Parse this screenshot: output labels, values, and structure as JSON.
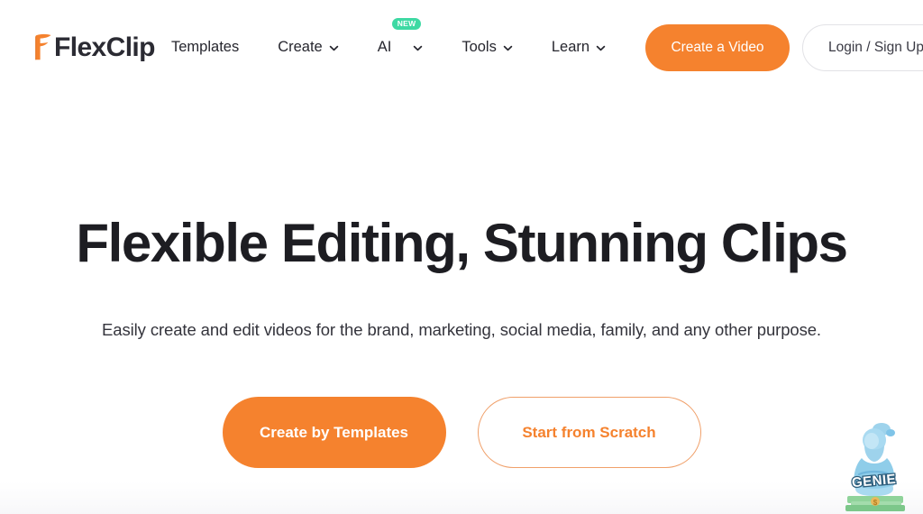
{
  "brand": {
    "name": "FlexClip",
    "logo_mark_icon": "flexclip-f-icon",
    "accent_color": "#F5822E",
    "logo_text_color": "#2B2B33"
  },
  "header": {
    "nav_items": [
      {
        "label": "Templates",
        "has_chevron": false,
        "badge": null,
        "icon": null
      },
      {
        "label": "Create",
        "has_chevron": true,
        "badge": null,
        "icon": "chevron-down-icon"
      },
      {
        "label": "AI",
        "has_chevron": true,
        "badge": "NEW",
        "icon": "chevron-down-icon"
      },
      {
        "label": "Tools",
        "has_chevron": true,
        "badge": null,
        "icon": "chevron-down-icon"
      },
      {
        "label": "Learn",
        "has_chevron": true,
        "badge": null,
        "icon": "chevron-down-icon"
      }
    ],
    "badge_new_label": "NEW",
    "badge_new_color": "#3ED9A3",
    "create_video_label": "Create a Video",
    "login_label": "Login / Sign Up"
  },
  "hero": {
    "title": "Flexible Editing, Stunning Clips",
    "subtitle": "Easily create and edit videos for the brand, marketing, social media, family, and any other purpose.",
    "primary_button_label": "Create by Templates",
    "secondary_button_label": "Start from Scratch"
  },
  "watermark": {
    "label": "GENIE",
    "icon": "genie-money-watermark-icon",
    "body_color": "#7FC4E8",
    "money_color": "#8FD39A"
  }
}
